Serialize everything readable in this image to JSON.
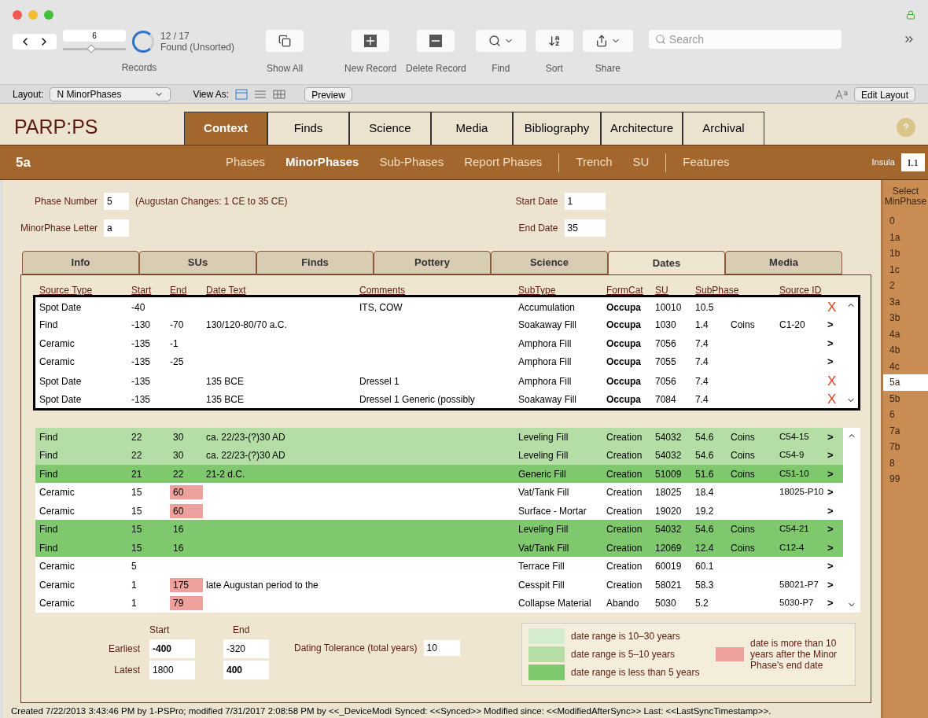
{
  "toolbar": {
    "record_number": "6",
    "record_slider": {
      "level": 0.45
    },
    "found_count": "12 / 17",
    "found_status": "Found (Unsorted)",
    "search": {
      "placeholder": "Search"
    },
    "buttons": [
      {
        "kind": "show_all",
        "label": "Show All"
      },
      {
        "kind": "new",
        "label": "New Record"
      },
      {
        "kind": "delete",
        "label": "Delete Record"
      },
      {
        "kind": "find",
        "label": "Find"
      },
      {
        "kind": "sort",
        "label": "Sort"
      },
      {
        "kind": "share",
        "label": "Share"
      }
    ],
    "records_label": "Records"
  },
  "layout_bar": {
    "layout_label": "Layout:",
    "layout_value": "N MinorPhases",
    "view_as_label": "View As:",
    "views": [
      {
        "kind": "form",
        "selected": true
      },
      {
        "kind": "list",
        "selected": false
      },
      {
        "kind": "table",
        "selected": false
      }
    ],
    "preview": "Preview",
    "edit_layout": "Edit Layout"
  },
  "app_title": "PARP:PS",
  "main_tabs": [
    {
      "label": "Context",
      "selected": true
    },
    {
      "label": "Finds",
      "selected": false
    },
    {
      "label": "Science",
      "selected": false
    },
    {
      "label": "Media",
      "selected": false
    },
    {
      "label": "Bibliography",
      "selected": false
    },
    {
      "label": "Architecture",
      "selected": false
    },
    {
      "label": "Archival",
      "selected": false
    }
  ],
  "record_id": "5a",
  "nav_groups": [
    [
      {
        "label": "Phases",
        "selected": false
      },
      {
        "label": "MinorPhases",
        "selected": true
      },
      {
        "label": "Sub-Phases",
        "selected": false
      },
      {
        "label": "Report Phases",
        "selected": false
      }
    ],
    [
      {
        "label": "Trench",
        "selected": false
      },
      {
        "label": "SU",
        "selected": false
      }
    ],
    [
      {
        "label": "Features",
        "selected": false
      }
    ]
  ],
  "insula": {
    "label": "Insula",
    "value": "I.1"
  },
  "form": {
    "phase_number_label": "Phase Number",
    "phase_number": "5",
    "phase_note": "(Augustan Changes: 1 CE to 35 CE)",
    "letter_label": "MinorPhase Letter",
    "letter": "a",
    "start_label": "Start Date",
    "start": "1",
    "end_label": "End Date",
    "end": "35"
  },
  "sub_tabs": [
    {
      "label": "Info",
      "selected": false
    },
    {
      "label": "SUs",
      "selected": false
    },
    {
      "label": "Finds",
      "selected": false
    },
    {
      "label": "Pottery",
      "selected": false
    },
    {
      "label": "Science",
      "selected": false
    },
    {
      "label": "Dates",
      "selected": true
    },
    {
      "label": "Media",
      "selected": false
    }
  ],
  "columns": [
    "Source Type",
    "Start",
    "End",
    "Date Text",
    "Comments",
    "SubType",
    "FormCat",
    "SU",
    "SubPhase",
    "Source ID"
  ],
  "upper_rows": [
    {
      "source_type": "Spot Date",
      "start": "-40",
      "end": "",
      "date_text": "",
      "comments": "ITS, COW",
      "subtype": "Accumulation",
      "formcat": "Occupa",
      "su": "10010",
      "subphase": "10.5",
      "category": "",
      "source_id": "",
      "kind": "delete",
      "action": "X"
    },
    {
      "source_type": "Find",
      "start": "-130",
      "end": "-70",
      "date_text": "130/120-80/70 a.C.",
      "comments": "",
      "subtype": "Soakaway Fill",
      "formcat": "Occupa",
      "su": "1030",
      "subphase": "1.4",
      "category": "Coins",
      "source_id": "C1-20",
      "kind": "open",
      "action": ">"
    },
    {
      "source_type": "Ceramic",
      "start": "-135",
      "end": "-1",
      "date_text": "",
      "comments": "",
      "subtype": "Amphora Fill",
      "formcat": "Occupa",
      "su": "7056",
      "subphase": "7.4",
      "category": "",
      "source_id": "",
      "kind": "open",
      "action": ">"
    },
    {
      "source_type": "Ceramic",
      "start": "-135",
      "end": "-25",
      "date_text": "",
      "comments": "",
      "subtype": "Amphora Fill",
      "formcat": "Occupa",
      "su": "7055",
      "subphase": "7.4",
      "category": "",
      "source_id": "",
      "kind": "open",
      "action": ">"
    },
    {
      "source_type": "Spot Date",
      "start": "-135",
      "end": "",
      "date_text": "135 BCE",
      "comments": "Dressel 1",
      "subtype": "Amphora Fill",
      "formcat": "Occupa",
      "su": "7056",
      "subphase": "7.4",
      "category": "",
      "source_id": "",
      "kind": "delete",
      "action": "X"
    },
    {
      "source_type": "Spot Date",
      "start": "-135",
      "end": "",
      "date_text": "135 BCE",
      "comments": "Dressel 1 Generic (possibly",
      "subtype": "Soakaway Fill",
      "formcat": "Occupa",
      "su": "7084",
      "subphase": "7.4",
      "category": "",
      "source_id": "",
      "kind": "delete",
      "action": "X"
    }
  ],
  "lower_rows": [
    {
      "color": "#b4dea6",
      "end_late": false,
      "source_type": "Find",
      "start": "22",
      "end": "30",
      "date_text": "ca. 22/23-(?)30 AD",
      "subtype": "Leveling Fill",
      "formcat": "Creation",
      "su": "54032",
      "subphase": "54.6",
      "category": "Coins",
      "source_id": "C54-15",
      "action": ">"
    },
    {
      "color": "#b4dea6",
      "end_late": false,
      "source_type": "Find",
      "start": "22",
      "end": "30",
      "date_text": "ca. 22/23-(?)30 AD",
      "subtype": "Leveling Fill",
      "formcat": "Creation",
      "su": "54032",
      "subphase": "54.6",
      "category": "Coins",
      "source_id": "C54-9",
      "action": ">"
    },
    {
      "color": "#80c86e",
      "end_late": false,
      "source_type": "Find",
      "start": "21",
      "end": "22",
      "date_text": "21-2 d.C.",
      "subtype": "Generic Fill",
      "formcat": "Creation",
      "su": "51009",
      "subphase": "51.6",
      "category": "Coins",
      "source_id": "C51-10",
      "action": ">"
    },
    {
      "color": "#ffffff",
      "end_late": true,
      "source_type": "Ceramic",
      "start": "15",
      "end": "60",
      "date_text": "",
      "subtype": "Vat/Tank Fill",
      "formcat": "Creation",
      "su": "18025",
      "subphase": "18.4",
      "category": "",
      "source_id": "18025-P10",
      "action": ">"
    },
    {
      "color": "#ffffff",
      "end_late": true,
      "source_type": "Ceramic",
      "start": "15",
      "end": "60",
      "date_text": "",
      "subtype": "Surface - Mortar",
      "formcat": "Creation",
      "su": "19020",
      "subphase": "19.2",
      "category": "",
      "source_id": "",
      "action": ">"
    },
    {
      "color": "#80c86e",
      "end_late": false,
      "source_type": "Find",
      "start": "15",
      "end": "16",
      "date_text": "",
      "subtype": "Leveling Fill",
      "formcat": "Creation",
      "su": "54032",
      "subphase": "54.6",
      "category": "Coins",
      "source_id": "C54-21",
      "action": ">"
    },
    {
      "color": "#80c86e",
      "end_late": false,
      "source_type": "Find",
      "start": "15",
      "end": "16",
      "date_text": "",
      "subtype": "Vat/Tank Fill",
      "formcat": "Creation",
      "su": "12069",
      "subphase": "12.4",
      "category": "Coins",
      "source_id": "C12-4",
      "action": ">"
    },
    {
      "color": "#ffffff",
      "source_type": "Ceramic",
      "start": "5",
      "end": "",
      "date_text": "",
      "subtype": "Terrace Fill",
      "formcat": "Creation",
      "su": "60019",
      "subphase": "60.1",
      "category": "",
      "source_id": "",
      "action": ">"
    },
    {
      "color": "#ffffff",
      "end_late": true,
      "source_type": "Ceramic",
      "start": "1",
      "end": "175",
      "date_text": "late Augustan period to the",
      "subtype": "Cesspit Fill",
      "formcat": "Creation",
      "su": "58021",
      "subphase": "58.3",
      "category": "",
      "source_id": "58021-P7",
      "action": ">"
    },
    {
      "color": "#ffffff",
      "end_late": true,
      "source_type": "Ceramic",
      "start": "1",
      "end": "79",
      "date_text": "",
      "subtype": "Collapse Material",
      "formcat": "Abando",
      "su": "5030",
      "subphase": "5.2",
      "category": "",
      "source_id": "5030-P7",
      "action": ">"
    }
  ],
  "range": {
    "start_label": "Start",
    "end_label": "End",
    "rows": [
      {
        "label": "Earliest",
        "start": "-400",
        "start_bold": true,
        "end": "-320",
        "end_bold": false
      },
      {
        "label": "Latest",
        "start": "1800",
        "start_bold": false,
        "end": "400",
        "end_bold": true
      }
    ]
  },
  "tolerance": {
    "label": "Dating Tolerance (total years)",
    "value": "10"
  },
  "legend": [
    {
      "kind": "range",
      "color": "#d5edcf",
      "label": "date range is 10–30 years"
    },
    {
      "kind": "range",
      "color": "#b4dea6",
      "label": "date range is 5–10 years"
    },
    {
      "kind": "range",
      "color": "#80c86e",
      "label": "date range is less than 5 years"
    },
    {
      "kind": "late",
      "color": "#eea19c",
      "label": "date is more than 10 years after the Minor Phase's end date"
    }
  ],
  "sidebar": {
    "title": "Select MinPhase",
    "items": [
      {
        "label": "0",
        "selected": false
      },
      {
        "label": "1a",
        "selected": false
      },
      {
        "label": "1b",
        "selected": false
      },
      {
        "label": "1c",
        "selected": false
      },
      {
        "label": "2",
        "selected": false
      },
      {
        "label": "3a",
        "selected": false
      },
      {
        "label": "3b",
        "selected": false
      },
      {
        "label": "4a",
        "selected": false
      },
      {
        "label": "4b",
        "selected": false
      },
      {
        "label": "4c",
        "selected": false
      },
      {
        "label": "5a",
        "selected": true
      },
      {
        "label": "5b",
        "selected": false
      },
      {
        "label": "6",
        "selected": false
      },
      {
        "label": "7a",
        "selected": false
      },
      {
        "label": "7b",
        "selected": false
      },
      {
        "label": "8",
        "selected": false
      },
      {
        "label": "99",
        "selected": false
      }
    ]
  },
  "status": [
    "Created 7/22/2013 3:43:46 PM by 1-PSPro; modified 7/31/2017 2:08:58 PM by <<_DeviceModi",
    "Synced: <<Synced>> Modified since: <<ModifiedAfterSync>> Last: <<LastSyncTimestamp>>."
  ]
}
